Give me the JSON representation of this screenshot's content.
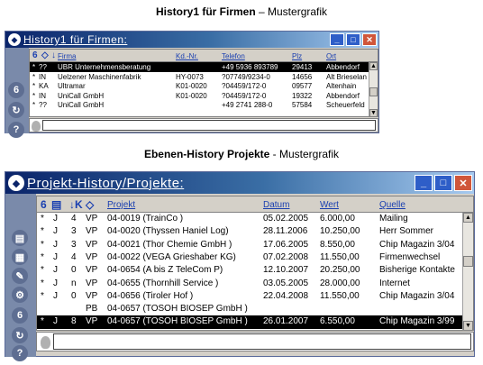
{
  "caption1": {
    "bold": "History1 für Firmen",
    "rest": " – Mustergrafik"
  },
  "caption2": {
    "bold": "Ebenen-History Projekte",
    "rest": " - Mustergrafik"
  },
  "win1": {
    "title": "History1 für Firmen:",
    "headers": {
      "firma": "Firma",
      "kdnr": "Kd.-Nr.",
      "telefon": "Telefon",
      "plz": "Plz",
      "ort": "Ort"
    },
    "rows": [
      {
        "flag": "*",
        "st": "??",
        "firma": "UBR Unternehmensberatung",
        "kdnr": "",
        "telefon": "+49 5936 893789",
        "plz": "29413",
        "ort": "Abbendorf",
        "selected": true
      },
      {
        "flag": "*",
        "st": "IN",
        "firma": "Uelzener Maschinenfabrik",
        "kdnr": "HY-0073",
        "telefon": "?07749/9234-0",
        "plz": "14656",
        "ort": "Alt Brieselan",
        "selected": false
      },
      {
        "flag": "*",
        "st": "KA",
        "firma": "Ultramar",
        "kdnr": "K01-0020",
        "telefon": "?04459/172-0",
        "plz": "09577",
        "ort": "Altenhain",
        "selected": false
      },
      {
        "flag": "*",
        "st": "IN",
        "firma": "UniCall GmbH",
        "kdnr": "K01-0020",
        "telefon": "?04459/172-0",
        "plz": "19322",
        "ort": "Abbendorf",
        "selected": false
      },
      {
        "flag": "*",
        "st": "??",
        "firma": "UniCall GmbH",
        "kdnr": "",
        "telefon": "+49 2741 288-0",
        "plz": "57584",
        "ort": "Scheuerfeld",
        "selected": false
      }
    ]
  },
  "win2": {
    "title": "Projekt-History/Projekte:",
    "headers": {
      "projekt": "Projekt",
      "datum": "Datum",
      "wert": "Wert",
      "quelle": "Quelle"
    },
    "rows": [
      {
        "flag": "*",
        "c1": "J",
        "c2": "4",
        "c3": "VP",
        "projekt": "04-0019 (TrainCo            )",
        "datum": "05.02.2005",
        "wert": "6.000,00",
        "quelle": "Mailing",
        "selected": false
      },
      {
        "flag": "*",
        "c1": "J",
        "c2": "3",
        "c3": "VP",
        "projekt": "04-0020 (Thyssen Haniel Log)",
        "datum": "28.11.2006",
        "wert": "10.250,00",
        "quelle": "Herr Sommer",
        "selected": false
      },
      {
        "flag": "*",
        "c1": "J",
        "c2": "3",
        "c3": "VP",
        "projekt": "04-0021 (Thor Chemie GmbH  )",
        "datum": "17.06.2005",
        "wert": "8.550,00",
        "quelle": "Chip Magazin 3/04",
        "selected": false
      },
      {
        "flag": "*",
        "c1": "J",
        "c2": "4",
        "c3": "VP",
        "projekt": "04-0022 (VEGA Grieshaber KG)",
        "datum": "07.02.2008",
        "wert": "11.550,00",
        "quelle": "Firmenwechsel",
        "selected": false
      },
      {
        "flag": "*",
        "c1": "J",
        "c2": "0",
        "c3": "VP",
        "projekt": "04-0654 (A bis Z TeleCom  P)",
        "datum": "12.10.2007",
        "wert": "20.250,00",
        "quelle": "Bisherige Kontakte",
        "selected": false
      },
      {
        "flag": "*",
        "c1": "J",
        "c2": "n",
        "c3": "VP",
        "projekt": "04-0655 (Thornhill Service )",
        "datum": "03.05.2005",
        "wert": "28.000,00",
        "quelle": "Internet",
        "selected": false
      },
      {
        "flag": "*",
        "c1": "J",
        "c2": "0",
        "c3": "VP",
        "projekt": "04-0656 (Tiroler Hof      )",
        "datum": "22.04.2008",
        "wert": "11.550,00",
        "quelle": "Chip Magazin 3/04",
        "selected": false
      },
      {
        "flag": "",
        "c1": "",
        "c2": "",
        "c3": "PB",
        "projekt": "04-0657 (TOSOH BIOSEP GmbH )",
        "datum": "",
        "wert": "",
        "quelle": "",
        "selected": false
      },
      {
        "flag": "*",
        "c1": "J",
        "c2": "8",
        "c3": "VP",
        "projekt": "04-0657 (TOSOH BIOSEP GmbH )",
        "datum": "26.01.2007",
        "wert": "6.550,00",
        "quelle": "Chip Magazin 3/99",
        "selected": true
      }
    ]
  }
}
